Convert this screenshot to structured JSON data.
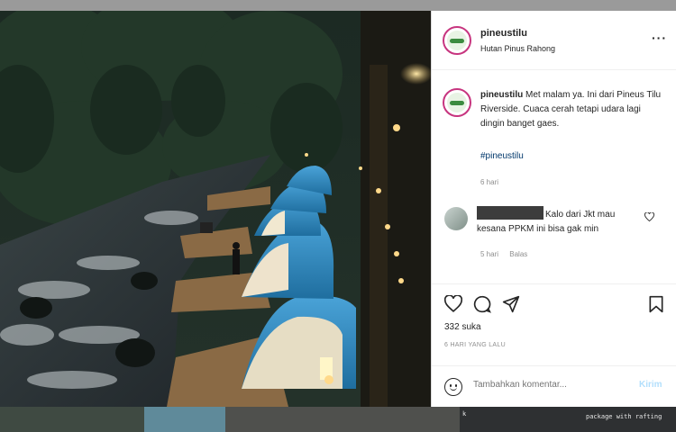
{
  "post": {
    "username": "pineustilu",
    "location": "Hutan Pinus Rahong",
    "more_icon": "more-horizontal-icon",
    "caption_username": "pineustilu",
    "caption_text": "Met malam ya. Ini dari Pineus Tilu Riverside. Cuaca cerah tetapi udara lagi dingin banget gaes.",
    "hashtag": "#pineustilu",
    "caption_age": "6 hari"
  },
  "comment": {
    "text": "Kalo dari Jkt mau kesana PPKM ini bisa gak min",
    "age": "5 hari",
    "reply_label": "Balas",
    "like_icon": "heart-outline-icon"
  },
  "actions": {
    "like_icon": "heart-icon",
    "comment_icon": "comment-icon",
    "share_icon": "send-icon",
    "save_icon": "bookmark-icon",
    "likes": "332 suka",
    "date": "6 HARI YANG LALU"
  },
  "add_comment": {
    "placeholder": "Tambahkan komentar...",
    "post_label": "Kirim",
    "emoji_icon": "smiley-icon"
  },
  "bottom_strip": {
    "thumb_text": "k",
    "thumb_text2": "package with rafting"
  },
  "colors": {
    "tent_blue": "#2f7fb6",
    "link": "#00376b",
    "post_button": "#b2dffc",
    "avatar_ring": "#c7357f"
  }
}
